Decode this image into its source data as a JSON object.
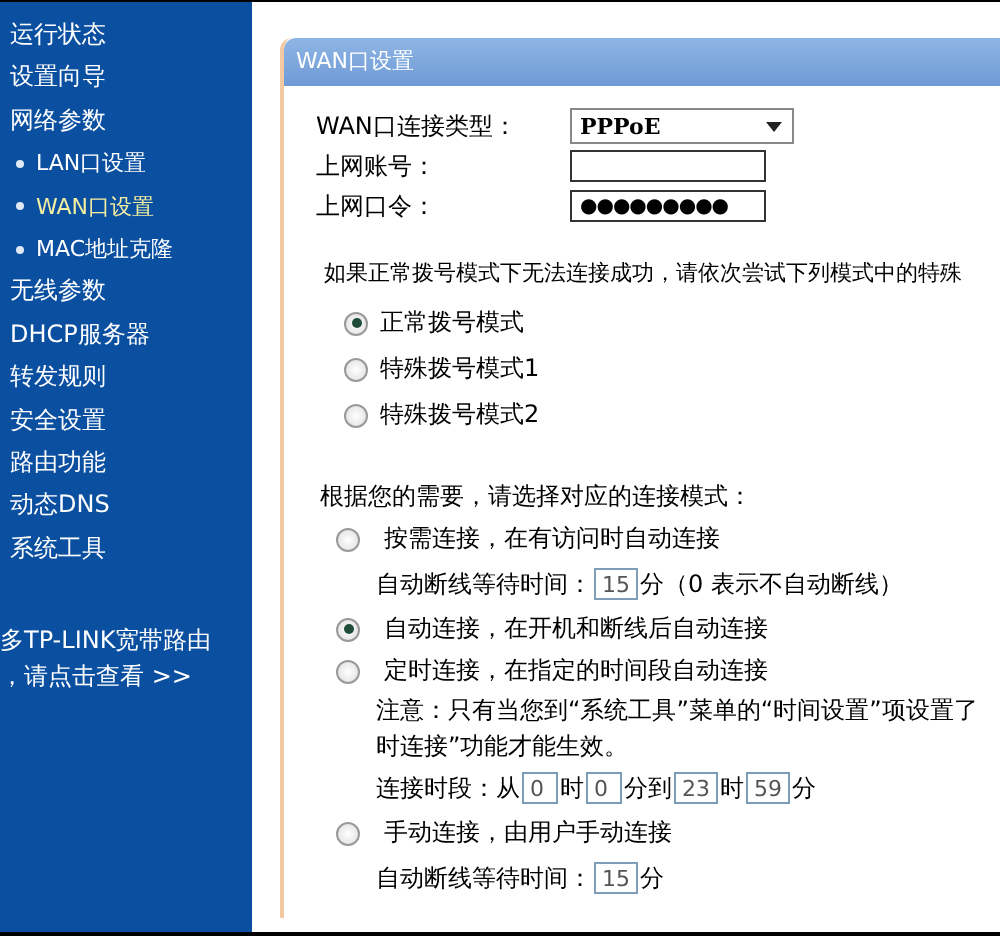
{
  "sidebar": {
    "items": [
      {
        "label": "运行状态",
        "selected": false
      },
      {
        "label": "设置向导",
        "selected": false
      },
      {
        "label": "网络参数",
        "selected": false,
        "children": [
          {
            "label": "LAN口设置",
            "selected": false
          },
          {
            "label": "WAN口设置",
            "selected": true
          },
          {
            "label": "MAC地址克隆",
            "selected": false
          }
        ]
      },
      {
        "label": "无线参数",
        "selected": false
      },
      {
        "label": "DHCP服务器",
        "selected": false
      },
      {
        "label": "转发规则",
        "selected": false
      },
      {
        "label": "安全设置",
        "selected": false
      },
      {
        "label": "路由功能",
        "selected": false
      },
      {
        "label": "动态DNS",
        "selected": false
      },
      {
        "label": "系统工具",
        "selected": false
      }
    ],
    "promo": [
      "多TP-LINK宽带路由",
      "，请点击查看 >>"
    ]
  },
  "panel": {
    "title": "WAN口设置",
    "fields": [
      {
        "label": "WAN口连接类型：",
        "kind": "select",
        "value": "PPPoE"
      },
      {
        "label": "上网账号：",
        "kind": "text"
      },
      {
        "label": "上网口令：",
        "kind": "password",
        "value": "●●●●●●●●●"
      }
    ],
    "dial_hint": "如果正常拨号模式下无法连接成功，请依次尝试下列模式中的特殊",
    "dial_modes": [
      {
        "label": "正常拨号模式",
        "selected": true
      },
      {
        "label": "特殊拨号模式1",
        "selected": false
      },
      {
        "label": "特殊拨号模式2",
        "selected": false
      }
    ],
    "connect_hint": "根据您的需要，请选择对应的连接模式：",
    "connect_modes": [
      {
        "label": "按需连接，在有访问时自动连接",
        "selected": false,
        "details": [
          [
            {
              "kind": "text",
              "text": "自动断线等待时间："
            },
            {
              "kind": "box",
              "value": "15"
            },
            {
              "kind": "text",
              "text": "分"
            },
            {
              "kind": "text",
              "text": "（0 表示不自动断线）"
            }
          ]
        ]
      },
      {
        "label": "自动连接，在开机和断线后自动连接",
        "selected": true
      },
      {
        "label": "定时连接，在指定的时间段自动连接",
        "selected": false,
        "details": [
          [
            {
              "kind": "note",
              "text": "注意：只有当您到“系统工具”菜单的“时间设置”项设置了"
            }
          ],
          [
            {
              "kind": "note",
              "text": "时连接”功能才能生效。"
            }
          ],
          [
            {
              "kind": "text",
              "text": "连接时段：从"
            },
            {
              "kind": "box",
              "value": "0"
            },
            {
              "kind": "text",
              "text": "时"
            },
            {
              "kind": "box",
              "value": "0"
            },
            {
              "kind": "text",
              "text": "分到"
            },
            {
              "kind": "box",
              "value": "23"
            },
            {
              "kind": "text",
              "text": "时"
            },
            {
              "kind": "box",
              "value": "59"
            },
            {
              "kind": "text",
              "text": "分"
            }
          ]
        ]
      },
      {
        "label": "手动连接，由用户手动连接",
        "selected": false,
        "details": [
          [
            {
              "kind": "text",
              "text": "自动断线等待时间："
            },
            {
              "kind": "box",
              "value": "15"
            },
            {
              "kind": "text",
              "text": "分"
            }
          ]
        ]
      }
    ]
  }
}
